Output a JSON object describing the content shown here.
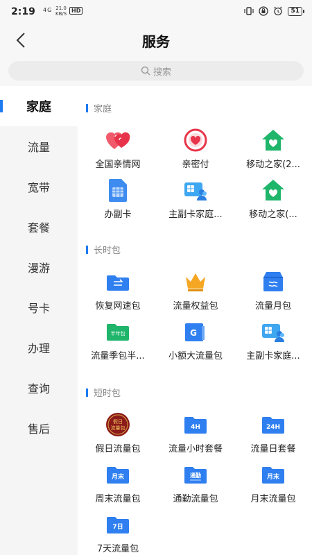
{
  "status": {
    "time": "2:19",
    "net": "4G",
    "speed_top": "21.0",
    "speed_bottom": "KB/S",
    "hd": "HD",
    "battery": "51"
  },
  "header": {
    "title": "服务"
  },
  "search": {
    "placeholder": "搜索"
  },
  "sidebar": {
    "items": [
      {
        "label": "家庭"
      },
      {
        "label": "流量"
      },
      {
        "label": "宽带"
      },
      {
        "label": "套餐"
      },
      {
        "label": "漫游"
      },
      {
        "label": "号卡"
      },
      {
        "label": "办理"
      },
      {
        "label": "查询"
      },
      {
        "label": "售后"
      }
    ]
  },
  "sections": [
    {
      "title": "家庭",
      "items": [
        {
          "label": "全国亲情网",
          "icon": "hearts-icon"
        },
        {
          "label": "亲密付",
          "icon": "heart-circle-icon"
        },
        {
          "label": "移动之家(2...",
          "icon": "home-heart-icon"
        },
        {
          "label": "办副卡",
          "icon": "sim-card-icon"
        },
        {
          "label": "主副卡家庭...",
          "icon": "sim-family-icon"
        },
        {
          "label": "移动之家(...",
          "icon": "home-heart-icon"
        }
      ]
    },
    {
      "title": "长时包",
      "items": [
        {
          "label": "恢复网速包",
          "icon": "restore-speed-icon"
        },
        {
          "label": "流量权益包",
          "icon": "crown-icon"
        },
        {
          "label": "流量月包",
          "icon": "wave-box-icon"
        },
        {
          "label": "流量季包半...",
          "icon": "half-year-icon",
          "badge": "半年包"
        },
        {
          "label": "小额大流量包",
          "icon": "g-data-icon",
          "badge": "G"
        },
        {
          "label": "主副卡家庭...",
          "icon": "sim-family-icon"
        }
      ]
    },
    {
      "title": "短时包",
      "items": [
        {
          "label": "假日流量包",
          "icon": "holiday-icon",
          "badge": "假日流量包"
        },
        {
          "label": "流量小时套餐",
          "icon": "hour-icon",
          "badge": "4H"
        },
        {
          "label": "流量日套餐",
          "icon": "day-icon",
          "badge": "24H"
        },
        {
          "label": "周末流量包",
          "icon": "weekend-icon",
          "badge": "月末"
        },
        {
          "label": "通勤流量包",
          "icon": "commute-icon",
          "badge": "通勤"
        },
        {
          "label": "月末流量包",
          "icon": "month-end-icon",
          "badge": "月末"
        },
        {
          "label": "7天流量包",
          "icon": "seven-day-icon",
          "badge": "7日"
        }
      ]
    }
  ],
  "colors": {
    "accent": "#1e7bf0",
    "green": "#1fb56a",
    "red": "#e8344a"
  }
}
